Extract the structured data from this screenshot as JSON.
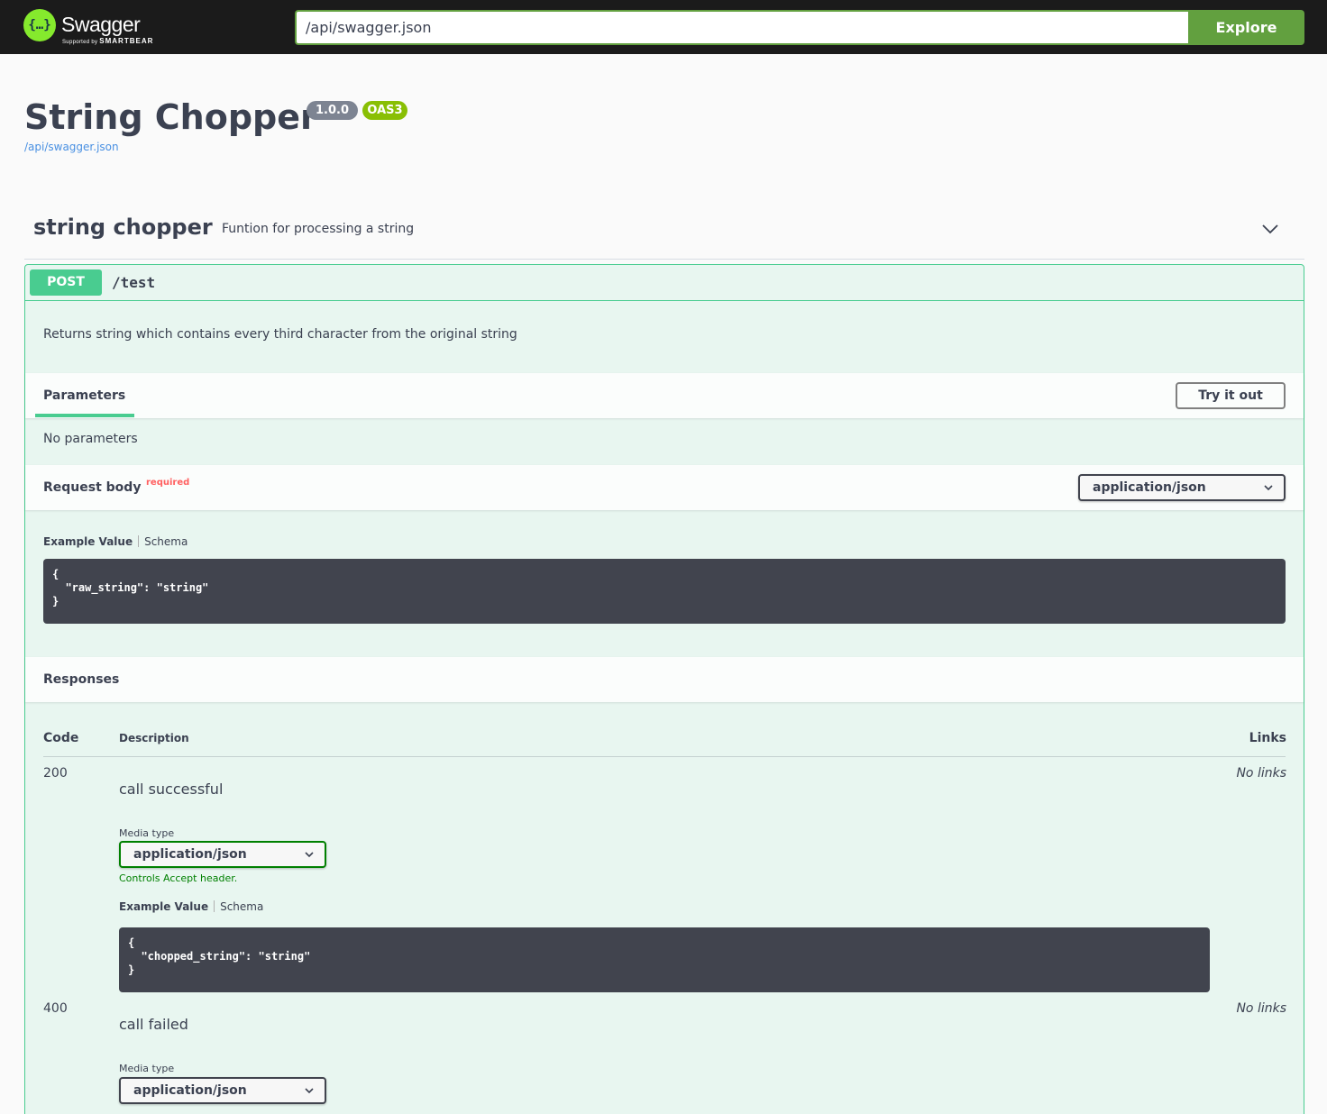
{
  "topbar": {
    "logo_name": "Swagger",
    "logo_sub_prefix": "Supported by",
    "logo_sub_brand": "SMARTBEAR",
    "logo_glyph": "{…}",
    "url_value": "/api/swagger.json",
    "explore_label": "Explore",
    "accent": "#62a03f",
    "logo_color": "#85ea2d"
  },
  "info": {
    "title": "String Chopper",
    "version": "1.0.0",
    "oas": "OAS3",
    "spec_url": "/api/swagger.json"
  },
  "tag": {
    "name": "string chopper",
    "description": "Funtion for processing a string",
    "toggle_icon": "chevron-down-icon"
  },
  "operation": {
    "method": "POST",
    "path": "/test",
    "description": "Returns string which contains every third character from the original string",
    "method_color": "#49cc90",
    "parameters": {
      "title": "Parameters",
      "try_label": "Try it out",
      "empty_text": "No parameters"
    },
    "request_body": {
      "title": "Request body",
      "required": "required",
      "content_type": "application/json",
      "example_tab": "Example Value",
      "schema_tab": "Schema",
      "example": "{\n  \"raw_string\": \"string\"\n}"
    },
    "responses": {
      "title": "Responses",
      "col_code": "Code",
      "col_description": "Description",
      "col_links": "Links",
      "items": [
        {
          "code": "200",
          "description": "call successful",
          "links": "No links",
          "media_label": "Media type",
          "media_type": "application/json",
          "controls": "Controls Accept header.",
          "example_tab": "Example Value",
          "schema_tab": "Schema",
          "example": "{\n  \"chopped_string\": \"string\"\n}"
        },
        {
          "code": "400",
          "description": "call failed",
          "links": "No links",
          "media_label": "Media type",
          "media_type": "application/json"
        }
      ]
    }
  }
}
